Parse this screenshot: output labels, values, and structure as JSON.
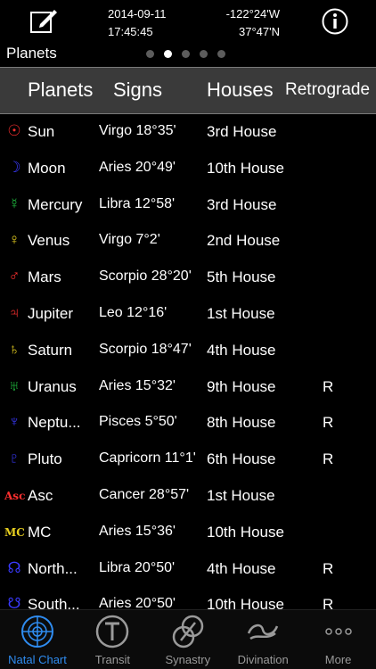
{
  "status": {
    "date": "2014-09-11",
    "time": "17:45:45",
    "longitude": "-122°24'W",
    "latitude": "37°47'N"
  },
  "page": {
    "label": "Planets",
    "dots": 5,
    "active_dot": 1
  },
  "header": {
    "planets": "Planets",
    "signs": "Signs",
    "houses": "Houses",
    "retrograde": "Retrograde"
  },
  "colors": {
    "accent": "#2f8cf0",
    "header_bg": "#3a3a3a"
  },
  "rows": [
    {
      "symbol": "☉",
      "color": "#ff3030",
      "planet": "Sun",
      "sign": "Virgo 18°35'",
      "house": "3rd House",
      "retro": ""
    },
    {
      "symbol": "☽",
      "color": "#3a3aff",
      "planet": "Moon",
      "sign": "Aries 20°49'",
      "house": "10th House",
      "retro": ""
    },
    {
      "symbol": "☿",
      "color": "#20c040",
      "planet": "Mercury",
      "sign": "Libra 12°58'",
      "house": "3rd House",
      "retro": ""
    },
    {
      "symbol": "♀",
      "color": "#e8d020",
      "planet": "Venus",
      "sign": "Virgo 7°2'",
      "house": "2nd House",
      "retro": ""
    },
    {
      "symbol": "♂",
      "color": "#ff3030",
      "planet": "Mars",
      "sign": "Scorpio 28°20'",
      "house": "5th House",
      "retro": ""
    },
    {
      "symbol": "♃",
      "color": "#ff3030",
      "planet": "Jupiter",
      "sign": "Leo 12°16'",
      "house": "1st House",
      "retro": ""
    },
    {
      "symbol": "♄",
      "color": "#e8d020",
      "planet": "Saturn",
      "sign": "Scorpio 18°47'",
      "house": "4th House",
      "retro": ""
    },
    {
      "symbol": "♅",
      "color": "#20c040",
      "planet": "Uranus",
      "sign": "Aries 15°32'",
      "house": "9th House",
      "retro": "R"
    },
    {
      "symbol": "♆",
      "color": "#3a3aff",
      "planet": "Neptu...",
      "sign": "Pisces 5°50'",
      "house": "8th House",
      "retro": "R"
    },
    {
      "symbol": "♇",
      "color": "#3a3aff",
      "planet": "Pluto",
      "sign": "Capricorn 11°1'",
      "house": "6th House",
      "retro": "R"
    },
    {
      "symbol": "Asc",
      "color": "#ff3030",
      "planet": "Asc",
      "sign": "Cancer 28°57'",
      "house": "1st House",
      "retro": ""
    },
    {
      "symbol": "MC",
      "color": "#e8d020",
      "planet": "MC",
      "sign": "Aries 15°36'",
      "house": "10th House",
      "retro": ""
    },
    {
      "symbol": "☊",
      "color": "#3a3aff",
      "planet": "North...",
      "sign": "Libra 20°50'",
      "house": "4th House",
      "retro": "R"
    },
    {
      "symbol": "☋",
      "color": "#3a3aff",
      "planet": "South...",
      "sign": "Aries 20°50'",
      "house": "10th House",
      "retro": "R"
    }
  ],
  "tabs": [
    {
      "label": "Natal Chart",
      "icon": "natal-chart-icon",
      "active": true
    },
    {
      "label": "Transit",
      "icon": "transit-icon",
      "active": false
    },
    {
      "label": "Synastry",
      "icon": "synastry-icon",
      "active": false
    },
    {
      "label": "Divination",
      "icon": "divination-icon",
      "active": false
    },
    {
      "label": "More",
      "icon": "more-icon",
      "active": false
    }
  ]
}
